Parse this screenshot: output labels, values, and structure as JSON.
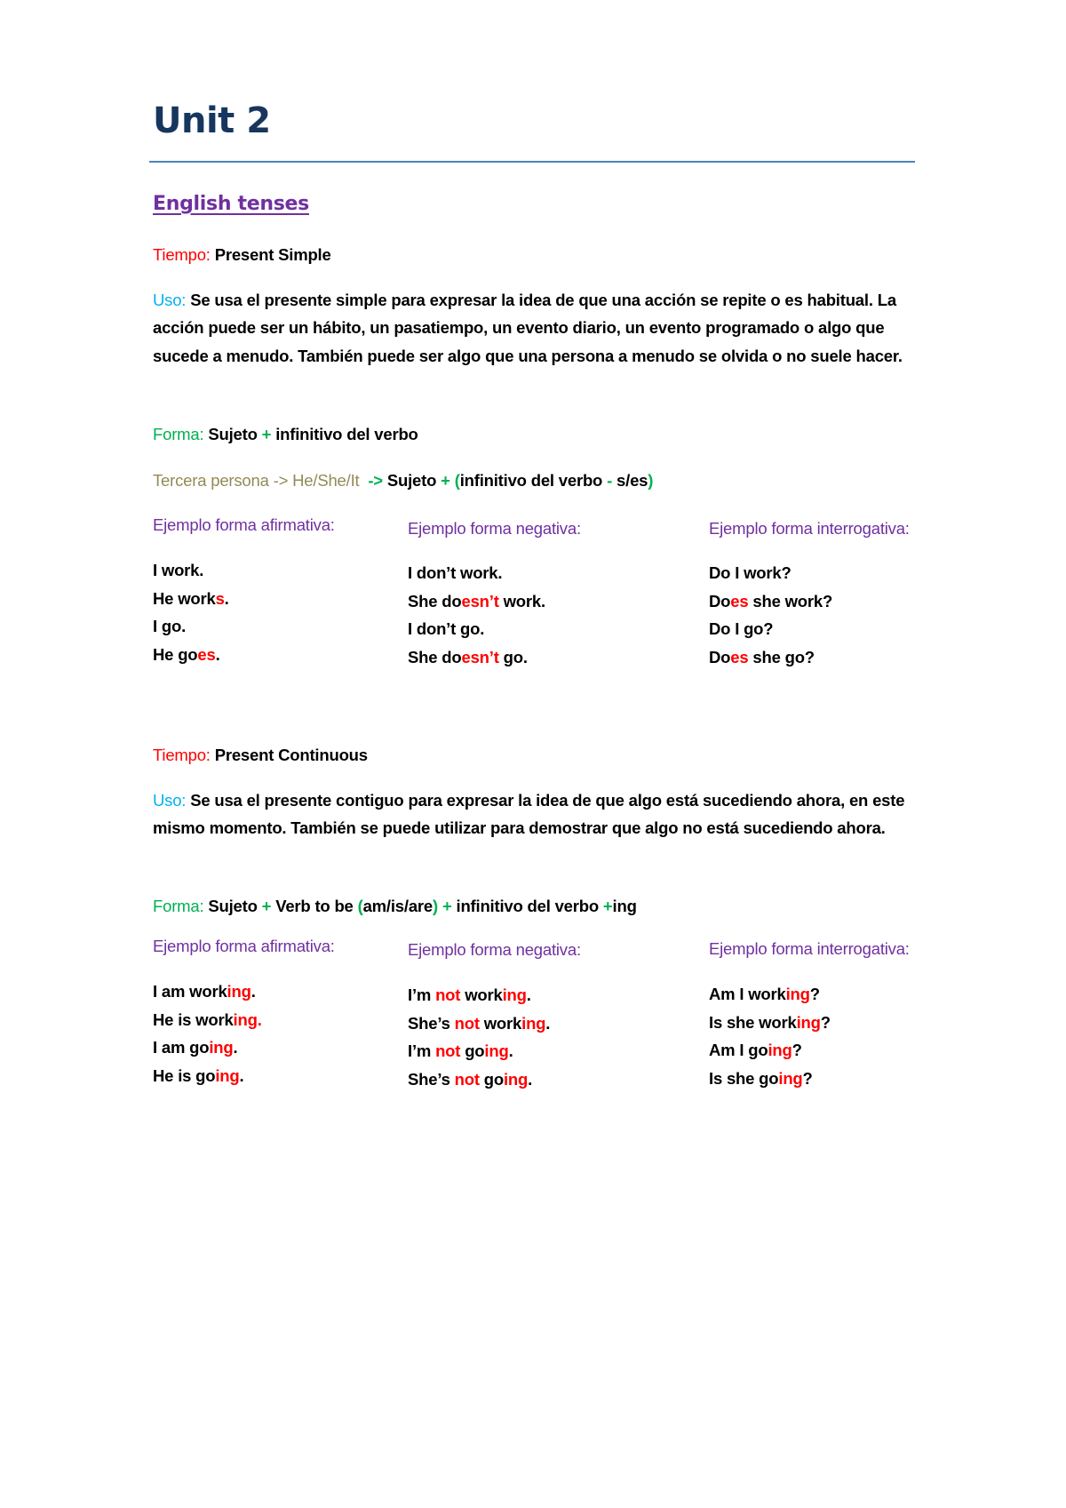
{
  "document": {
    "title": "Unit 2",
    "subtitle": "English tenses",
    "colors": {
      "title": "#17365d",
      "rule": "#4f81bd",
      "subtitle": "#7030a0",
      "tiempo_label": "#ff0000",
      "uso_label": "#00b0f0",
      "forma_label": "#00b050",
      "tercera_label": "#948a54",
      "example_heading": "#7030a0",
      "highlight": "#ff0000"
    }
  },
  "sections": [
    {
      "tiempo_label": "Tiempo:",
      "tiempo_value": "Present Simple",
      "uso_label": "Uso:",
      "uso_text": "Se usa el presente simple para expresar la idea de que una acción se repite o es habitual. La acción puede ser un hábito, un pasatiempo, un evento diario, un evento programado o algo que sucede a menudo. También puede ser algo que una persona a menudo se olvida o no suele hacer.",
      "forma_label": "Forma:",
      "forma": {
        "p1": "Sujeto",
        "plus1": "+",
        "p2": "infinitivo del verbo"
      },
      "tercera": {
        "label": "Tercera persona -> He/She/It",
        "arrow": "->",
        "p1": "Sujeto",
        "plus": "+",
        "open": "(",
        "p2": "infinitivo del verbo",
        "dash": "-",
        "p3": "s/es",
        "close": ")"
      },
      "columns": [
        {
          "heading": "Ejemplo forma afirmativa:",
          "examples": [
            {
              "pre": "I work.",
              "hl": "",
              "post": ""
            },
            {
              "pre": "He work",
              "hl": "s",
              "post": "."
            },
            {
              "pre": "I go.",
              "hl": "",
              "post": ""
            },
            {
              "pre": "He go",
              "hl": "es",
              "post": "."
            }
          ]
        },
        {
          "heading": "Ejemplo forma negativa:",
          "examples": [
            {
              "pre": "I don’t work.",
              "hl": "",
              "post": ""
            },
            {
              "pre": "She do",
              "hl": "esn’t",
              "post": " work."
            },
            {
              "pre": "I don’t go.",
              "hl": "",
              "post": ""
            },
            {
              "pre": "She do",
              "hl": "esn’t",
              "post": " go."
            }
          ]
        },
        {
          "heading": "Ejemplo forma interrogativa:",
          "examples": [
            {
              "pre": "Do I work?",
              "hl": "",
              "post": ""
            },
            {
              "pre": "Do",
              "hl": "es",
              "post": " she work?"
            },
            {
              "pre": "Do I go?",
              "hl": "",
              "post": ""
            },
            {
              "pre": "Do",
              "hl": "es",
              "post": " she go?"
            }
          ]
        }
      ]
    },
    {
      "tiempo_label": "Tiempo:",
      "tiempo_value": "Present Continuous",
      "uso_label": "Uso:",
      "uso_text": "Se usa el presente contiguo para expresar la idea de que algo está sucediendo ahora, en este mismo momento. También se puede utilizar para demostrar que algo no está sucediendo ahora.",
      "forma_label": "Forma:",
      "forma": {
        "p1": "Sujeto",
        "plus1": "+",
        "p2": "Verb to be",
        "open": "(",
        "p3": "am/is/are",
        "close": ")",
        "plus2": "+",
        "p4": "infinitivo del verbo",
        "plus3": "+",
        "p5": "ing"
      },
      "columns": [
        {
          "heading": "Ejemplo forma afirmativa:",
          "examples": [
            {
              "a": "I am work",
              "b": "ing",
              "c": ".",
              "c_red": false
            },
            {
              "a": "He is work",
              "b": "ing",
              "c": ".",
              "c_red": true
            },
            {
              "a": "I am go",
              "b": "ing",
              "c": ".",
              "c_red": false
            },
            {
              "a": "He is go",
              "b": "ing",
              "c": ".",
              "c_red": false
            }
          ]
        },
        {
          "heading": "Ejemplo forma negativa:",
          "examples": [
            {
              "a": "I’m ",
              "n": "not",
              "a2": " work",
              "b": "ing",
              "c": "."
            },
            {
              "a": "She’s ",
              "n": "not",
              "a2": " work",
              "b": "ing",
              "c": "."
            },
            {
              "a": "I’m ",
              "n": "not",
              "a2": " go",
              "b": "ing",
              "c": "."
            },
            {
              "a": "She’s ",
              "n": "not",
              "a2": " go",
              "b": "ing",
              "c": "."
            }
          ]
        },
        {
          "heading": "Ejemplo forma interrogativa:",
          "examples": [
            {
              "a": "Am I work",
              "b": "ing",
              "c": "?"
            },
            {
              "a": "Is she work",
              "b": "ing",
              "c": "?"
            },
            {
              "a": "Am I go",
              "b": "ing",
              "c": "?"
            },
            {
              "a": "Is she go",
              "b": "ing",
              "c": "?"
            }
          ]
        }
      ]
    }
  ]
}
